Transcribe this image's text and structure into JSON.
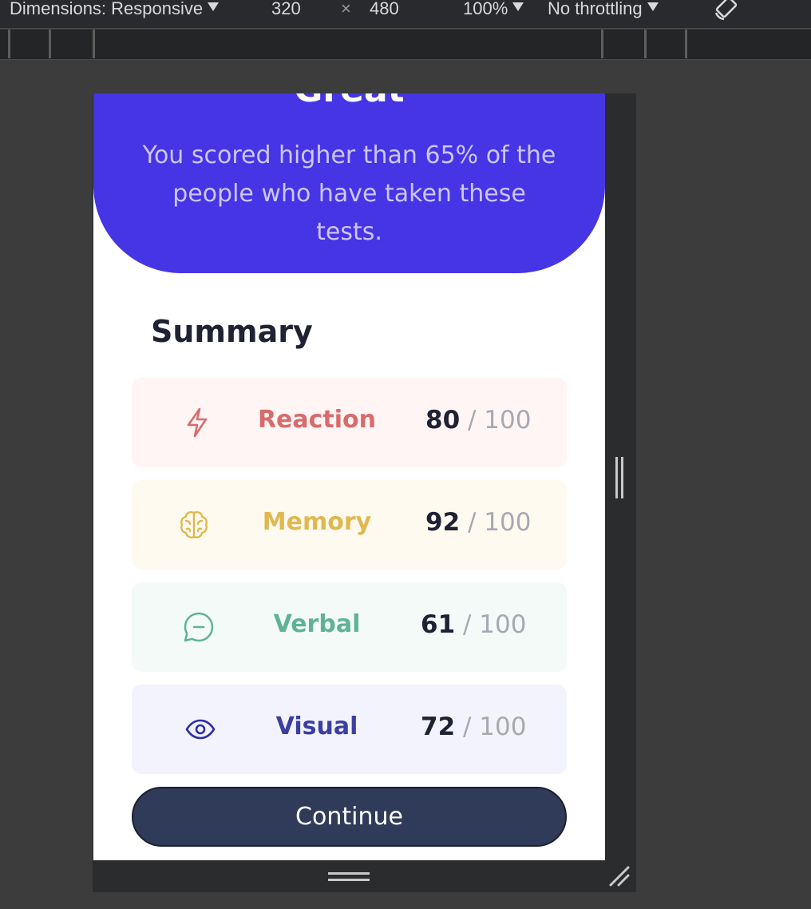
{
  "devtools": {
    "dimensions_label": "Dimensions: Responsive",
    "width": "320",
    "times": "×",
    "height": "480",
    "zoom": "100%",
    "throttling": "No throttling"
  },
  "result": {
    "title": "Great",
    "message": "You scored higher than 65% of the people who have taken these tests."
  },
  "summary": {
    "title": "Summary",
    "items": [
      {
        "label": "Reaction",
        "score": "80",
        "max": "/ 100",
        "icon": "lightning-icon",
        "color": "#d86b6b",
        "bg": "#fff5f4"
      },
      {
        "label": "Memory",
        "score": "92",
        "max": "/ 100",
        "icon": "brain-icon",
        "color": "#e0b84f",
        "bg": "#fffaf0"
      },
      {
        "label": "Verbal",
        "score": "61",
        "max": "/ 100",
        "icon": "chat-bubble-icon",
        "color": "#5fb394",
        "bg": "#f3faf8"
      },
      {
        "label": "Visual",
        "score": "72",
        "max": "/ 100",
        "icon": "eye-icon",
        "color": "#2c2fa4",
        "bg": "#f3f3fd"
      }
    ]
  },
  "continue_label": "Continue"
}
